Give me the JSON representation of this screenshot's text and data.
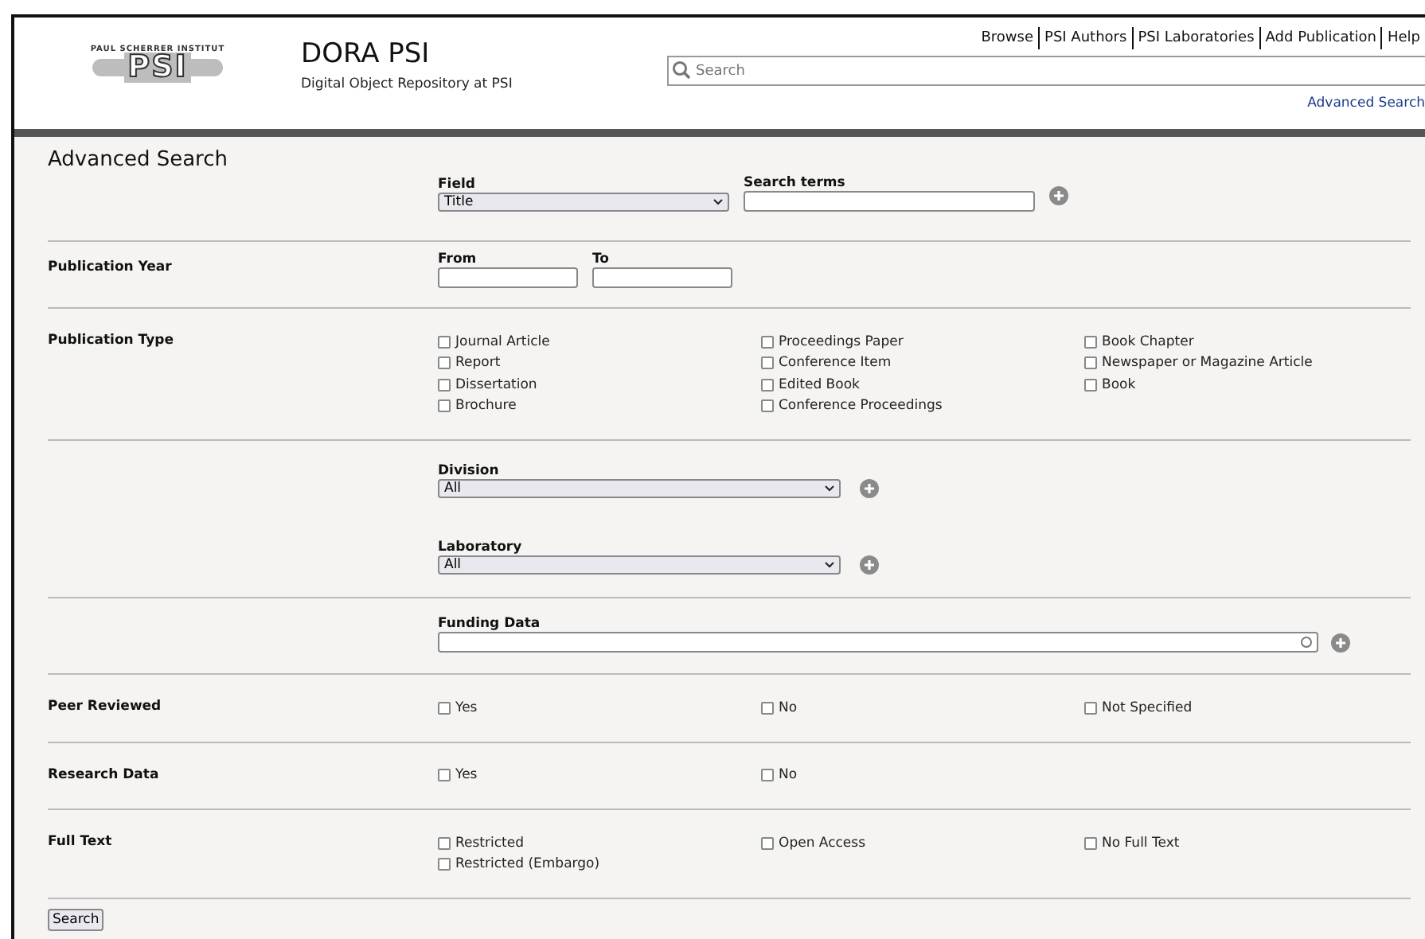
{
  "header": {
    "logo_caption": "PAUL SCHERRER INSTITUT",
    "logo": "PSI",
    "title": "DORA PSI",
    "subtitle": "Digital Object Repository at PSI",
    "nav": [
      "Browse",
      "PSI Authors",
      "PSI Laboratories",
      "Add Publication",
      "Help"
    ],
    "search": {
      "placeholder": "Search"
    },
    "advanced_link": "Advanced Search"
  },
  "page_title": "Advanced Search",
  "sections": [
    {
      "kind": "terms",
      "field_label": "Field",
      "field_value": "Title",
      "terms_label": "Search terms"
    },
    {
      "kind": "year",
      "label": "Publication Year",
      "from_label": "From",
      "to_label": "To"
    },
    {
      "kind": "checks",
      "label": "Publication Type",
      "columns": [
        [
          {
            "label": "Journal Article",
            "checked": false
          },
          {
            "label": "Report",
            "checked": false
          },
          {
            "label": "Dissertation",
            "checked": false
          },
          {
            "label": "Brochure",
            "checked": false
          }
        ],
        [
          {
            "label": "Proceedings Paper",
            "checked": false
          },
          {
            "label": "Conference Item",
            "checked": false
          },
          {
            "label": "Edited Book",
            "checked": false
          },
          {
            "label": "Conference Proceedings",
            "checked": false
          }
        ],
        [
          {
            "label": "Book Chapter",
            "checked": false
          },
          {
            "label": "Newspaper or Magazine Article",
            "checked": false
          },
          {
            "label": "Book",
            "checked": false
          }
        ]
      ]
    },
    {
      "kind": "selects",
      "selects": [
        {
          "label": "Division",
          "value": "All"
        },
        {
          "label": "Laboratory",
          "value": "All"
        }
      ]
    },
    {
      "kind": "funding",
      "field_label": "Funding Data"
    },
    {
      "kind": "checks",
      "label": "Peer Reviewed",
      "columns": [
        [
          {
            "label": "Yes",
            "checked": false
          }
        ],
        [
          {
            "label": "No",
            "checked": false
          }
        ],
        [
          {
            "label": "Not Specified",
            "checked": false
          }
        ]
      ]
    },
    {
      "kind": "checks",
      "label": "Research Data",
      "columns": [
        [
          {
            "label": "Yes",
            "checked": false
          }
        ],
        [
          {
            "label": "No",
            "checked": false
          }
        ]
      ]
    },
    {
      "kind": "checks",
      "label": "Full Text",
      "columns": [
        [
          {
            "label": "Restricted",
            "checked": false
          },
          {
            "label": "Restricted (Embargo)",
            "checked": false
          }
        ],
        [
          {
            "label": "Open Access",
            "checked": false
          }
        ],
        [
          {
            "label": "No Full Text",
            "checked": false
          }
        ]
      ]
    }
  ],
  "submit": "Search"
}
